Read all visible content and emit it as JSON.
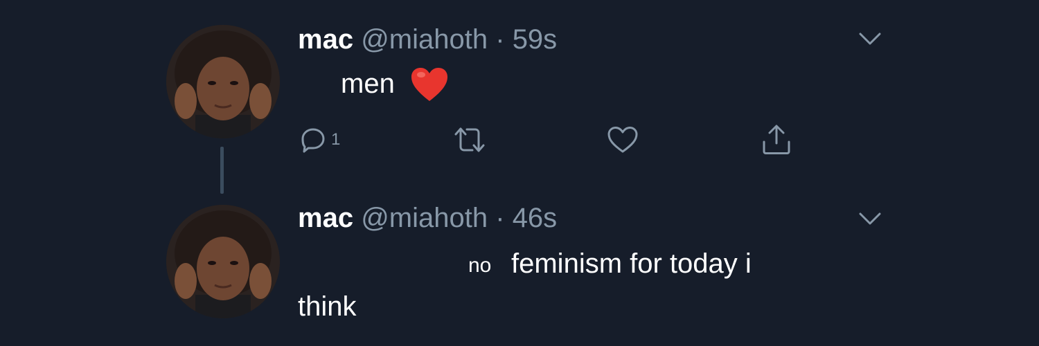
{
  "tweets": [
    {
      "display_name": "mac",
      "handle": "@miahoth",
      "separator": "·",
      "time": "59s",
      "text": "men",
      "emoji": "red-heart",
      "reply_count": "1"
    },
    {
      "display_name": "mac",
      "handle": "@miahoth",
      "separator": "·",
      "time": "46s",
      "text_small": "no",
      "text_line1": "feminism for today i",
      "text_line2": "think"
    }
  ],
  "icons": {
    "reply": "reply-icon",
    "retweet": "retweet-icon",
    "like": "heart-outline-icon",
    "share": "share-icon",
    "more": "chevron-down-icon"
  },
  "colors": {
    "background": "#161d2a",
    "text": "#ffffff",
    "secondary": "#8898a8",
    "thread_line": "#3b4c5e",
    "emoji_heart": "#e8352e"
  }
}
